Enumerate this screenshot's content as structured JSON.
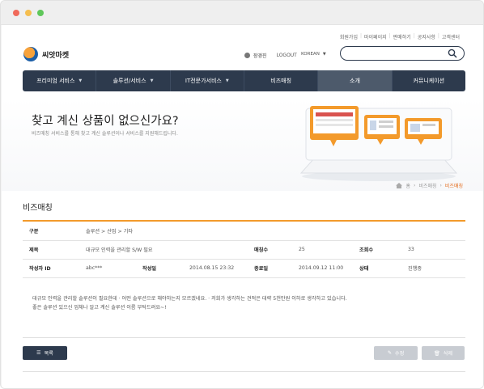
{
  "window": {
    "controls": [
      "close",
      "minimize",
      "maximize"
    ]
  },
  "header": {
    "util_links": [
      "회원가입",
      "마이페이지",
      "판매하기",
      "공지사항",
      "고객센터"
    ],
    "logo_text": "씨앗마켓",
    "user_name": "장경진",
    "logout_label": "LOGOUT",
    "language": "KOREAN",
    "search_placeholder": ""
  },
  "nav": {
    "items": [
      {
        "label": "프리미엄 서비스",
        "caret": true
      },
      {
        "label": "솔루션/서비스",
        "caret": true
      },
      {
        "label": "IT전문가서비스",
        "caret": true
      },
      {
        "label": "비즈매칭",
        "caret": false
      },
      {
        "label": "소개",
        "caret": false
      },
      {
        "label": "커뮤니케이션",
        "caret": false
      }
    ],
    "active_index": 4
  },
  "hero": {
    "title": "찾고 계신 상품이 없으신가요?",
    "subtitle": "비즈매칭 서비스를 통해 찾고 계신 솔루션이나 서비스를 지원해드립니다."
  },
  "breadcrumb": [
    "홈",
    "비즈매칭",
    "비즈매칭"
  ],
  "section_title": "비즈매칭",
  "detail": {
    "category_label": "구분",
    "category_value": "솔루션 > 산업 > 기타",
    "title_label": "제목",
    "title_value": "대규모 인력을 관리할 S/W 필요",
    "match_label": "매칭수",
    "match_value": "25",
    "views_label": "조회수",
    "views_value": "33",
    "author_label": "작성자 ID",
    "author_value": "abc***",
    "created_label": "작성일",
    "created_value": "2014.08.15 23:32",
    "end_label": "종료일",
    "end_value": "2014.09.12 11:00",
    "status_label": "상태",
    "status_value": "진행중"
  },
  "body_text": [
    "대규모 인력을 관리할 솔루션이 필요한데 · 어떤 솔루션으로 해야하는지 모르겠네요. · 저희가 생각하는 견적은 대략 5천만원 이하로 생각하고 있습니다.",
    "좋은 솔루션 있으신 업체나 알고 계신 솔루션 이름 부탁드려요~!"
  ],
  "buttons": {
    "list": "목록",
    "edit": "수정",
    "delete": "삭제"
  },
  "colors": {
    "nav_bg": "#2d3a4d",
    "accent_orange": "#f39a2b",
    "breadcrumb_current": "#e46b1a",
    "button_disabled": "#c8ccd2"
  }
}
